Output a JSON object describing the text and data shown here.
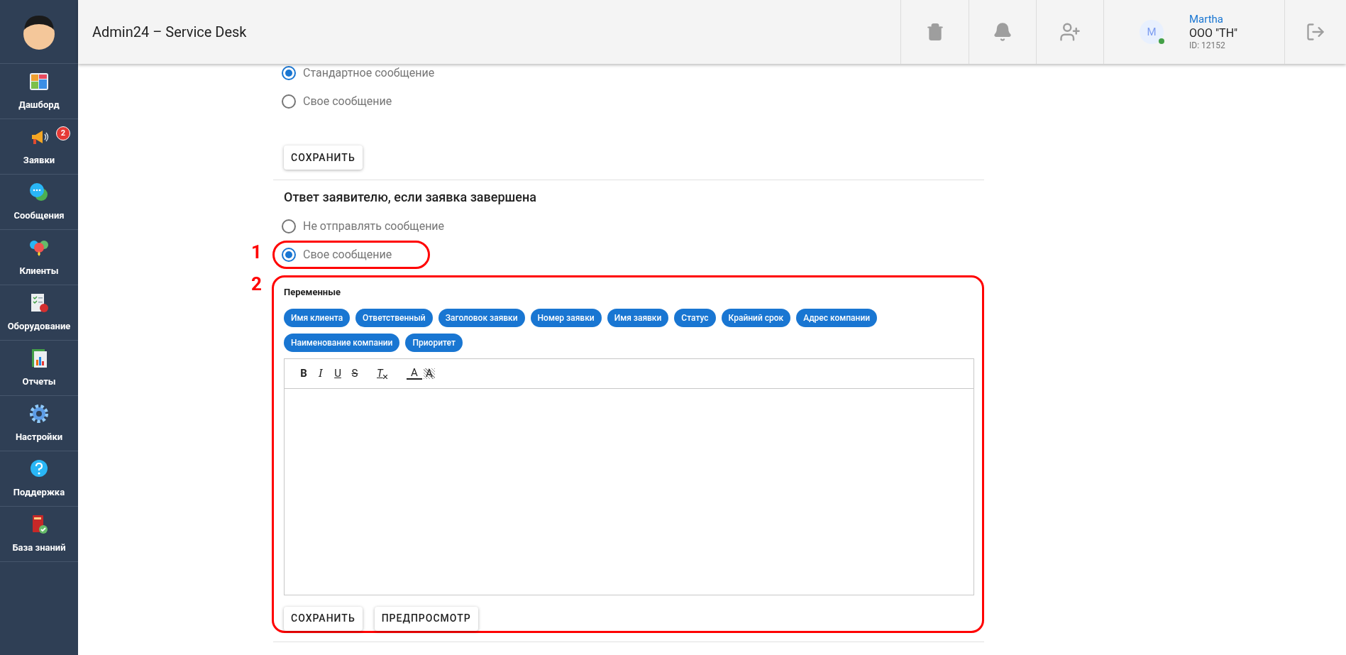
{
  "header": {
    "title": "Admin24 – Service Desk",
    "user": {
      "avatar": "M",
      "online": true,
      "name": "Martha",
      "company": "ООО \"ТН\"",
      "id": "ID: 12152"
    }
  },
  "sidebar": {
    "items": [
      {
        "label": "Дашборд",
        "selected": false
      },
      {
        "label": "Заявки",
        "selected": false,
        "badge": "2"
      },
      {
        "label": "Сообщения",
        "selected": false
      },
      {
        "label": "Клиенты",
        "selected": false
      },
      {
        "label": "Оборудование",
        "selected": false
      },
      {
        "label": "Отчеты",
        "selected": false
      },
      {
        "label": "Настройки",
        "selected": false
      },
      {
        "label": "Поддержка",
        "selected": false
      },
      {
        "label": "База знаний",
        "selected": false
      }
    ]
  },
  "section_1": {
    "options": [
      {
        "label": "Стандартное сообщение",
        "selected": true
      },
      {
        "label": "Свое сообщение",
        "selected": false
      }
    ],
    "save_button": "СОХРАНИТЬ"
  },
  "section_2": {
    "title": "Ответ заявителю, если заявка завершена",
    "options": [
      {
        "label": "Не отправлять сообщение",
        "selected": false
      },
      {
        "label": "Свое сообщение",
        "selected": true,
        "annotation": "1"
      }
    ],
    "editor": {
      "annotation": "2",
      "variables_label": "Переменные",
      "variables": [
        "Имя клиента",
        "Ответственный",
        "Заголовок заявки",
        "Номер заявки",
        "Имя заявки",
        "Статус",
        "Крайний срок",
        "Адрес компании",
        "Наименование компании",
        "Приоритет"
      ],
      "toolbar": [
        {
          "kind": "bold",
          "label": "B"
        },
        {
          "kind": "italic",
          "label": "I"
        },
        {
          "kind": "underline",
          "label": "U"
        },
        {
          "kind": "strike",
          "label": "S"
        },
        {
          "kind": "clear",
          "label": "T"
        },
        {
          "kind": "color",
          "label": "A"
        },
        {
          "kind": "background",
          "label": "A"
        }
      ],
      "buttons": [
        "СОХРАНИТЬ",
        "ПРЕДПРОСМОТР"
      ]
    }
  }
}
